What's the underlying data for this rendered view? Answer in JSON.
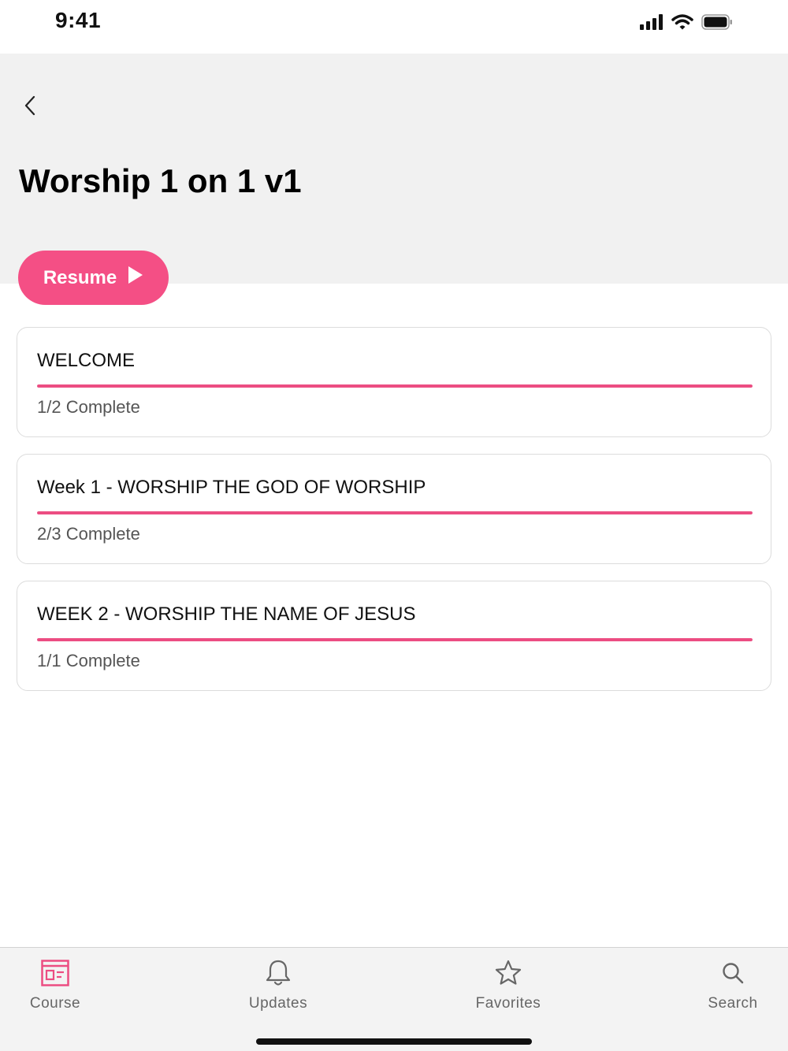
{
  "status_bar": {
    "time": "9:41",
    "icons": [
      "signal-icon",
      "wifi-icon",
      "battery-icon"
    ]
  },
  "header": {
    "title": "Worship 1 on 1 v1",
    "back_icon": "chevron-left-icon",
    "background": "#f1f1f1"
  },
  "resume_button": {
    "label": "Resume",
    "icon": "play-icon",
    "color": "#f44f85"
  },
  "sections": [
    {
      "title": "WELCOME",
      "status": "1/2 Complete",
      "progress": 1.0
    },
    {
      "title": "Week 1 - WORSHIP THE GOD OF WORSHIP",
      "status": "2/3 Complete",
      "progress": 1.0
    },
    {
      "title": "WEEK 2 - WORSHIP THE NAME OF JESUS",
      "status": "1/1 Complete",
      "progress": 1.0
    }
  ],
  "accent_color": "#ec4d82",
  "tab_bar": {
    "tabs": [
      {
        "label": "Course",
        "icon": "course-icon",
        "active": true
      },
      {
        "label": "Updates",
        "icon": "bell-icon",
        "active": false
      },
      {
        "label": "Favorites",
        "icon": "star-icon",
        "active": false
      },
      {
        "label": "Search",
        "icon": "search-icon",
        "active": false
      }
    ]
  }
}
